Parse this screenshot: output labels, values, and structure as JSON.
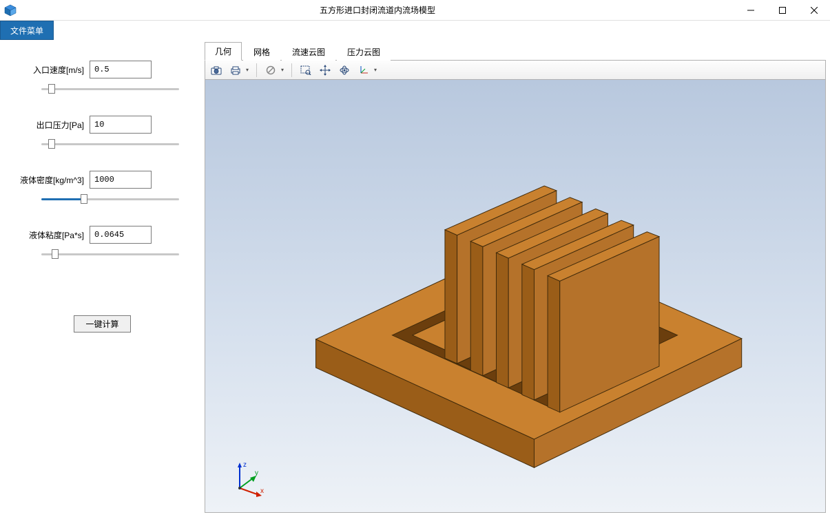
{
  "window": {
    "title": "五方形进口封闭流道内流场模型"
  },
  "menubar": {
    "file_label": "文件菜单"
  },
  "params": {
    "inlet_velocity": {
      "label": "入口速度[m/s]",
      "value": "0.5",
      "slider_pct": 5
    },
    "outlet_pressure": {
      "label": "出口压力[Pa]",
      "value": "10",
      "slider_pct": 5
    },
    "density": {
      "label": "液体密度[kg/m^3]",
      "value": "1000",
      "slider_pct": 30
    },
    "viscosity": {
      "label": "液体粘度[Pa*s]",
      "value": "0.0645",
      "slider_pct": 8
    }
  },
  "compute_button_label": "一键计算",
  "tabs": [
    {
      "label": "几何",
      "active": true
    },
    {
      "label": "网格",
      "active": false
    },
    {
      "label": "流速云图",
      "active": false
    },
    {
      "label": "压力云图",
      "active": false
    }
  ],
  "toolbar_icons": [
    "camera-icon",
    "print-icon",
    "disable-icon",
    "zoom-box-icon",
    "pan-icon",
    "rotate-icon",
    "axis-icon"
  ],
  "axis_labels": {
    "x": "x",
    "y": "y",
    "z": "z"
  },
  "colors": {
    "model_top": "#c9812f",
    "model_left": "#9a5d18",
    "model_right": "#b5722a",
    "model_edge": "#402a0a",
    "accent": "#1f6fb2"
  }
}
